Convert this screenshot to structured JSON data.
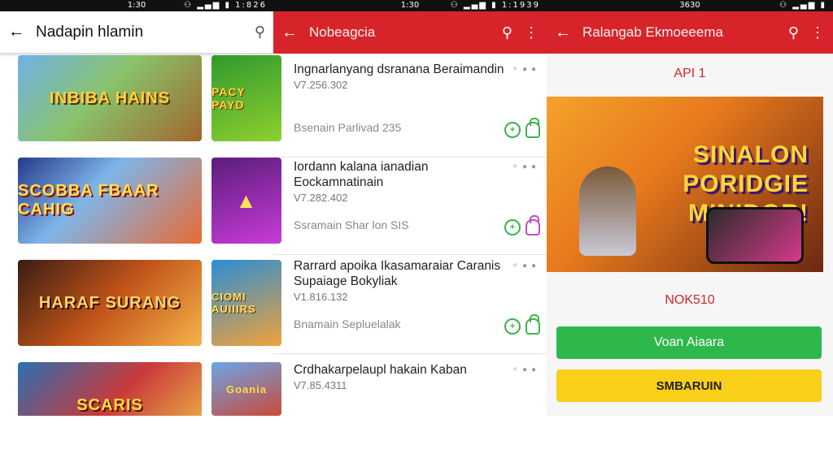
{
  "screen1": {
    "status_time": "1:30",
    "status_right": "1:826",
    "title": "Nadapin hlamin",
    "items": [
      {
        "banner_text": "INBIBA HAINS"
      },
      {
        "banner_text": "SCOBBA FBAAR CAHIG"
      },
      {
        "banner_text": "HARAF SURANG"
      },
      {
        "banner_text": "SCARIS"
      }
    ]
  },
  "screen2": {
    "status_time": "1:30",
    "status_right": "1:1939",
    "title": "Nobeagcia",
    "rows": [
      {
        "thumb": "PACY PAYD",
        "title": "Ingnarlanyang dsranana Beraimandin",
        "version": "V7.256.302",
        "meta": "Bsenain Parlivad 235"
      },
      {
        "thumb": "",
        "title": "Iordann kalana ianadian Eockamnatinain",
        "version": "V7.282.402",
        "meta": "Ssramain Shar lon SIS"
      },
      {
        "thumb": "CIOMI AUIIIRS",
        "title": "Rarrard apoika Ikasamaraiar Caranis Supaiage Bokyliak",
        "version": "V1.816.132",
        "meta": "Bnamain Sepluelalak"
      },
      {
        "thumb": "Goania",
        "title": "Crdhakarpelaupl hakain Kaban",
        "version": "V7.85.4311",
        "meta": ""
      }
    ]
  },
  "screen3": {
    "status_time": "3630",
    "title": "Ralangab Ekmoeeema",
    "api_label": "API 1",
    "hero_lines": [
      "SINALON",
      "PORIDGIE",
      "MINIDOR!"
    ],
    "price": "NOK510",
    "primary_button": "Voan Aiaara",
    "secondary_button": "SMBARUIN"
  },
  "icons": {
    "back": "arrow-back-icon",
    "search": "search-icon",
    "more": "more-vert-icon"
  },
  "colors": {
    "red_bar": "#d6242a",
    "green_button": "#2eb84b",
    "yellow_button": "#f9cf1a"
  }
}
